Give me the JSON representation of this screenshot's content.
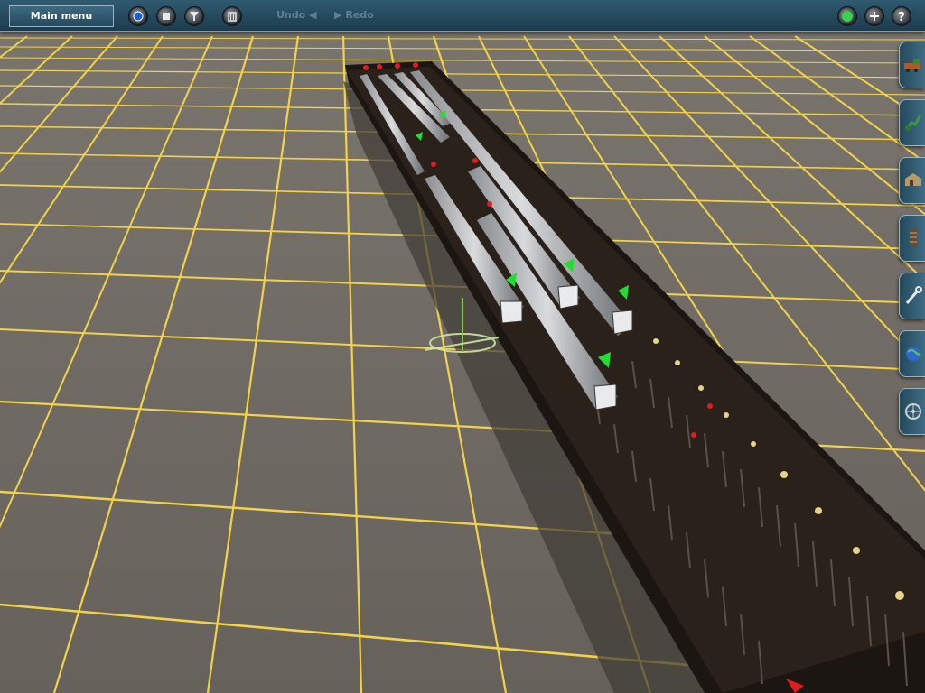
{
  "toolbar": {
    "main_menu_label": "Main menu",
    "undo_label": "Undo",
    "redo_label": "Redo",
    "left_tools": [
      "camera-icon",
      "stop-icon",
      "filter-icon",
      "trash-icon"
    ],
    "right_tools": [
      "layer-icon",
      "add-icon",
      "help-icon"
    ]
  },
  "side_tabs": [
    {
      "name": "side-tab-trains",
      "icon": "locomotive-icon"
    },
    {
      "name": "side-tab-track",
      "icon": "track-tool-icon"
    },
    {
      "name": "side-tab-objects",
      "icon": "building-icon"
    },
    {
      "name": "side-tab-track-objects",
      "icon": "rail-segment-icon"
    },
    {
      "name": "side-tab-tools",
      "icon": "wrench-icon"
    },
    {
      "name": "side-tab-topology",
      "icon": "globe-icon"
    },
    {
      "name": "side-tab-settings",
      "icon": "wheel-icon"
    }
  ],
  "colors": {
    "ground": "#6c6760",
    "grid": "#f6d84a",
    "toolbar": "#234a5e",
    "signal_green": "#22dd33",
    "signal_red": "#e01d1d"
  }
}
